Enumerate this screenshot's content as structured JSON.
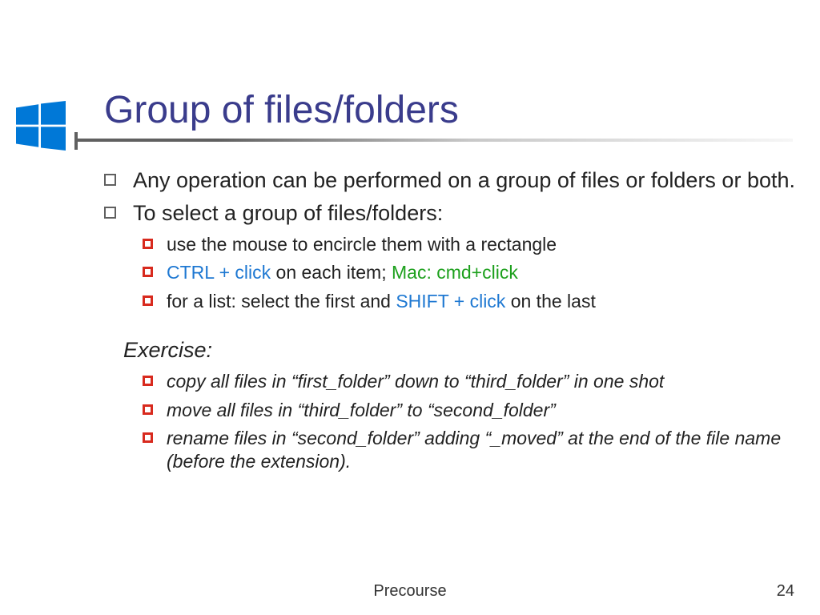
{
  "title": "Group of files/folders",
  "bullets": {
    "b1": "Any operation can be performed on a group of files or folders or both.",
    "b2": "To select a group of files/folders:",
    "sub1": "use the mouse to encircle them with a rectangle",
    "sub2_a": "CTRL + click",
    "sub2_b": " on each item; ",
    "sub2_c": "Mac: cmd+click",
    "sub3_a": "for a list: select the first and ",
    "sub3_b": "SHIFT + click",
    "sub3_c": " on the last"
  },
  "exercise": {
    "heading": "Exercise:",
    "e1": "copy all files in “first_folder” down to “third_folder” in one shot",
    "e2": "move all files in “third_folder”  to “second_folder”",
    "e3": "rename files in “second_folder” adding “_moved” at the end of the file name (before the extension)."
  },
  "footer": {
    "label": "Precourse",
    "page": "24"
  }
}
